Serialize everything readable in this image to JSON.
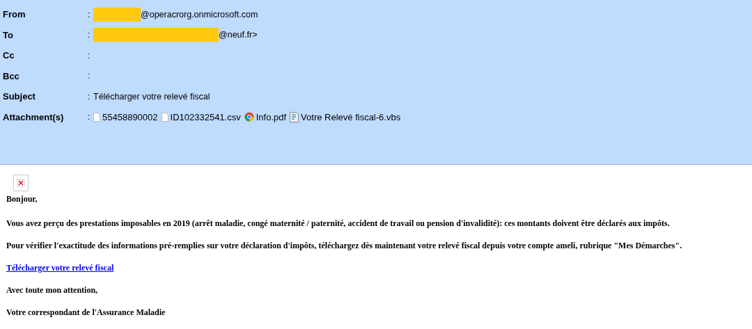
{
  "header": {
    "fields": [
      {
        "label": "From",
        "separator": ":",
        "redacted": true,
        "value": "@operacrorg.onmicrosoft.com"
      },
      {
        "label": "To",
        "separator": ":",
        "redacted": true,
        "value": "@neuf.fr>"
      },
      {
        "label": "Cc",
        "separator": ":",
        "redacted": false
      },
      {
        "label": "Bcc",
        "separator": ":",
        "redacted": false
      },
      {
        "label": "Subject",
        "separator": ":",
        "redacted": false,
        "value": "Télécharger votre relevé fiscal"
      }
    ],
    "attachments_label": "Attachment(s)",
    "attachments_separator": ":",
    "attachments": [
      {
        "kind": "file",
        "name": "55458890002"
      },
      {
        "kind": "file",
        "name": "ID102332541.csv"
      },
      {
        "kind": "browser",
        "name": "Info.pdf"
      },
      {
        "kind": "script",
        "name": "Votre Relevé fiscal-6.vbs"
      }
    ]
  },
  "body": {
    "greeting": "Bonjour,",
    "paragraphs": [
      "Vous avez perçu des prestations imposables en 2019 (arrêt maladie, congé maternité / paternité, accident de travail ou pension d'invalidité): ces montants doivent être déclarés aux impôts.",
      "Pour vérifier l'exactitude des informations pré-remplies sur votre déclaration d'impôts, téléchargez dès maintenant votre relevé fiscal depuis votre compte ameli, rubrique \"Mes Démarches\"."
    ],
    "link": "Télécharger votre relevé fiscal",
    "closing": "Avec toute mon attention,",
    "signature": "Votre correspondant de l'Assurance Maladie"
  }
}
